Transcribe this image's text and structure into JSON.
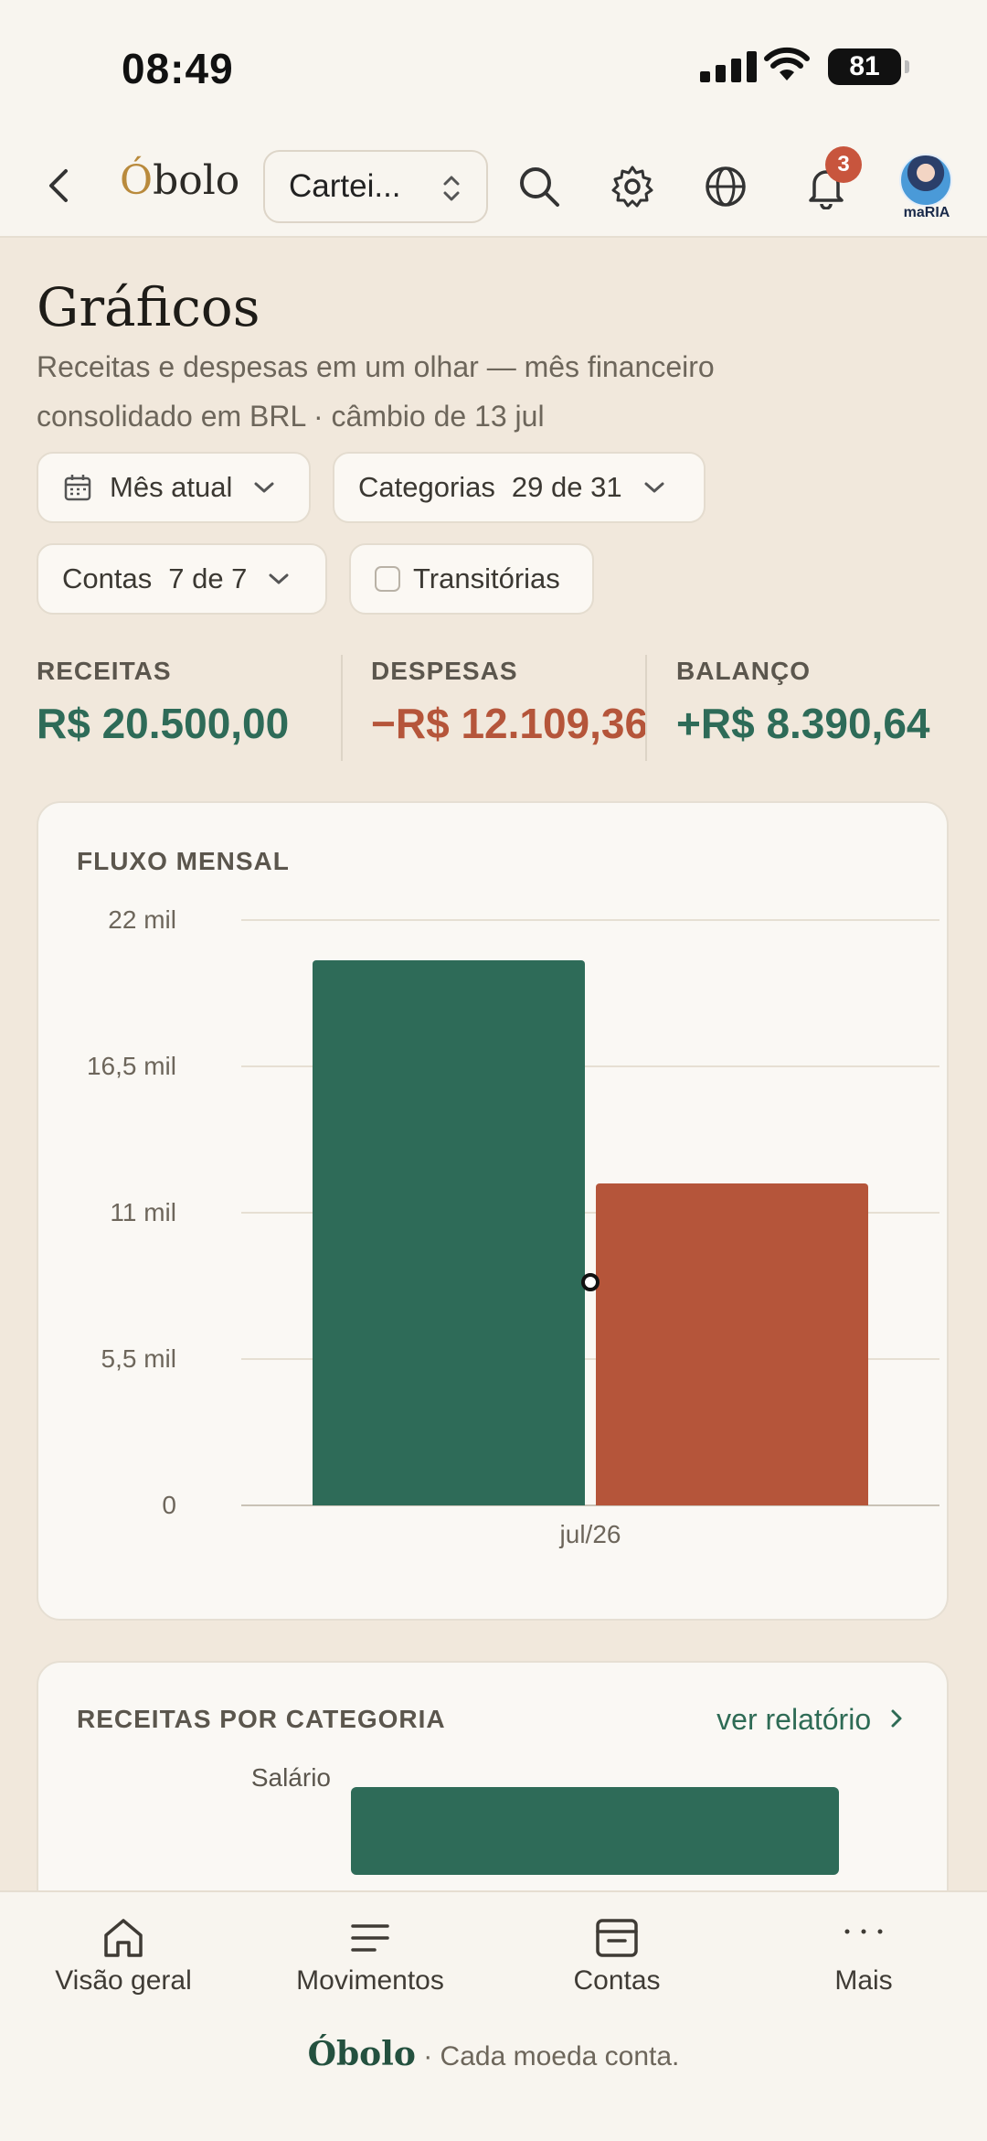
{
  "status_bar": {
    "time": "08:49",
    "battery": "81"
  },
  "header": {
    "brand_prefix": "Ó",
    "brand_rest": "bolo",
    "wallet_selector": "Cartei...",
    "notification_count": "3",
    "avatar_label": "maRIA"
  },
  "page": {
    "title": "Gráficos",
    "subtitle": "Receitas e despesas em um olhar — mês financeiro consolidado em BRL · câmbio de 13 jul"
  },
  "filters": {
    "period": "Mês atual",
    "categories_label": "Categorias",
    "categories_value": "29 de 31",
    "accounts_label": "Contas",
    "accounts_value": "7 de 7",
    "transitory": "Transitórias"
  },
  "summary": {
    "income_label": "RECEITAS",
    "income_value": "R$ 20.500,00",
    "expense_label": "DESPESAS",
    "expense_value": "−R$ 12.109,36",
    "balance_label": "BALANÇO",
    "balance_value": "+R$ 8.390,64"
  },
  "colors": {
    "income": "#2e6b58",
    "expense": "#b5553a",
    "brand_gold": "#b98a3c"
  },
  "chart_data": {
    "type": "bar",
    "title": "FLUXO MENSAL",
    "categories": [
      "jul/26"
    ],
    "series": [
      {
        "values": [
          20500.0
        ],
        "color": "#2e6b58"
      },
      {
        "values": [
          12109.36
        ],
        "color": "#b5553a"
      }
    ],
    "ylim": [
      0,
      22000
    ],
    "yticks": [
      {
        "value": 22000,
        "label": "22 mil"
      },
      {
        "value": 16500,
        "label": "16,5 mil"
      },
      {
        "value": 11000,
        "label": "11 mil"
      },
      {
        "value": 5500,
        "label": "5,5 mil"
      },
      {
        "value": 0,
        "label": "0"
      }
    ],
    "grid": true
  },
  "income_by_category": {
    "title": "RECEITAS POR CATEGORIA",
    "link": "ver relatório",
    "items": [
      {
        "label": "Salário",
        "value": 20500.0
      }
    ]
  },
  "bottom_nav": {
    "items": [
      {
        "label": "Visão geral",
        "icon": "home-icon"
      },
      {
        "label": "Movimentos",
        "icon": "list-icon"
      },
      {
        "label": "Contas",
        "icon": "archive-icon"
      },
      {
        "label": "Mais",
        "icon": "more-icon"
      }
    ],
    "footer_brand": "Óbolo",
    "footer_tagline": "· Cada moeda conta."
  }
}
